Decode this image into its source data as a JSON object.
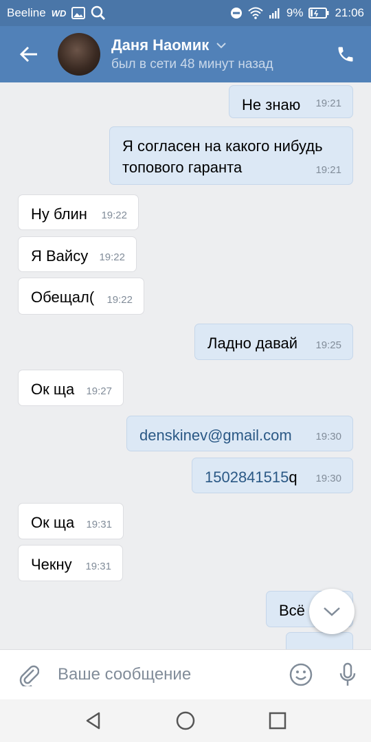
{
  "statusbar": {
    "carrier": "Beeline",
    "wifi_label": "WD",
    "battery": "9%",
    "time": "21:06",
    "icons": [
      "image-icon",
      "search-icon",
      "dnd-icon",
      "wifi-icon",
      "signal-icon",
      "battery-icon"
    ]
  },
  "header": {
    "contact_name": "Даня Наомик",
    "last_seen": "был в сети 48 минут назад",
    "back_icon": "back-arrow-icon",
    "call_icon": "phone-icon",
    "dropdown_icon": "chevron-down-icon"
  },
  "colors": {
    "header": "#5181b8",
    "statusbar": "#4a76a8",
    "chat_bg": "#edeef0",
    "bubble_in": "#ffffff",
    "bubble_out": "#dce8f5",
    "link": "#2a5885",
    "time": "#818c99"
  },
  "messages": [
    {
      "dir": "out",
      "text": "Не знаю",
      "time": "19:21"
    },
    {
      "dir": "out",
      "text": "Я согласен на какого нибудь\nтопового гаранта",
      "time": "19:21"
    },
    {
      "dir": "in",
      "text": "Ну блин",
      "time": "19:22"
    },
    {
      "dir": "in",
      "text": "Я Вайсу",
      "time": "19:22"
    },
    {
      "dir": "in",
      "text": "Обещал(",
      "time": "19:22"
    },
    {
      "dir": "out",
      "text": "Ладно давай",
      "time": "19:25"
    },
    {
      "dir": "in",
      "text": "Ок ща",
      "time": "19:27"
    },
    {
      "dir": "out",
      "text": "denskinev@gmail.com",
      "time": "19:30",
      "link": true
    },
    {
      "dir": "out",
      "text": "1502841515",
      "suffix": "q",
      "time": "19:30",
      "link": true
    },
    {
      "dir": "in",
      "text": "Ок ща",
      "time": "19:31"
    },
    {
      "dir": "in",
      "text": "Чекну",
      "time": "19:31"
    },
    {
      "dir": "out",
      "text": "Всё",
      "time": ""
    },
    {
      "dir": "out",
      "text": "?",
      "time": ""
    }
  ],
  "composer": {
    "placeholder": "Ваше сообщение",
    "attach_icon": "paperclip-icon",
    "emoji_icon": "smile-icon",
    "mic_icon": "microphone-icon"
  },
  "scroll_down_icon": "chevron-down-icon",
  "navbar": {
    "icons": [
      "back-triangle-icon",
      "home-circle-icon",
      "recents-square-icon"
    ]
  }
}
